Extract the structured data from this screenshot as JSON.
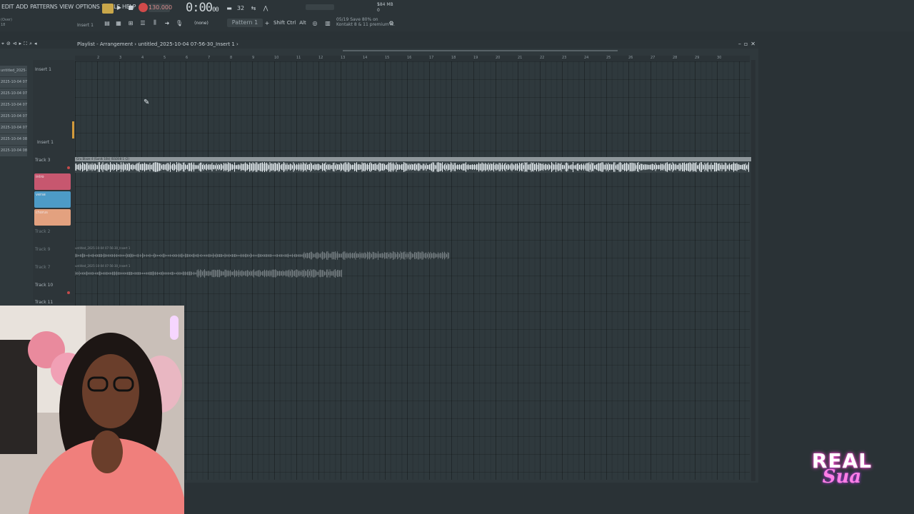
{
  "menu": [
    "EDIT",
    "ADD",
    "PATTERNS",
    "VIEW",
    "OPTIONS",
    "TOOLS",
    "HELP"
  ],
  "transport": {
    "tempo": "130.000",
    "time_main": "0:00",
    "time_sub": "00",
    "pattern": "Pattern 1",
    "snap": "(none)",
    "cpu_top": "1",
    "cpu_mem": "584 MB",
    "cpu_val": "0",
    "news_line1": "05/19 Save 80% on",
    "news_line2": "Kontakt 8 & 11 premium N.",
    "sub_label": "Insert 1",
    "left_small_line1": "(Over)",
    "left_small_line2": "18",
    "shift_label": "Shift",
    "ctrl_label": "Ctrl",
    "alt_label": "Alt"
  },
  "playlist": {
    "crumb_icon": "playlist-icon",
    "title": "Playlist - Arrangement",
    "crumb_sep": "›",
    "file": "untitled_2025-10-04 07-56-30_Insert 1",
    "crumb_end": "›",
    "browser_items": [
      "untitled_2025-10-04 07-",
      "2025-10-04 07-",
      "2025-10-04 07-",
      "2025-10-04 07-",
      "2025-10-04 07-",
      "2025-10-04 07-",
      "2025-10-04 08-",
      "2025-10-04 08-"
    ],
    "ruler": [
      "2",
      "3",
      "4",
      "5",
      "6",
      "7",
      "8",
      "9",
      "10",
      "11",
      "12",
      "13",
      "14",
      "15",
      "16",
      "17",
      "18",
      "19",
      "20",
      "21",
      "22",
      "23",
      "24",
      "25",
      "26",
      "27",
      "28",
      "29",
      "30"
    ],
    "tracks": [
      "Insert 1",
      "Insert 1",
      "Track 3",
      "Track 2",
      "Track 9",
      "Track 7",
      "Track 10",
      "Track 11"
    ],
    "patterns": [
      {
        "name": "intro",
        "color": "#c7576f"
      },
      {
        "name": "verse",
        "color": "#4d9bc7"
      },
      {
        "name": "chorus",
        "color": "#e3a17f"
      }
    ],
    "clip_main": "Gru Blaze 4 (Sunlk 10k) ISSO08 1 (2)",
    "clip_a": "untitled_2025-10-04 07-56-30_Insert 1",
    "clip_b": "untitled_2025-10-04 07-56-30_Insert 1"
  },
  "logo": {
    "line1": "REAL",
    "line2": "Sua"
  }
}
